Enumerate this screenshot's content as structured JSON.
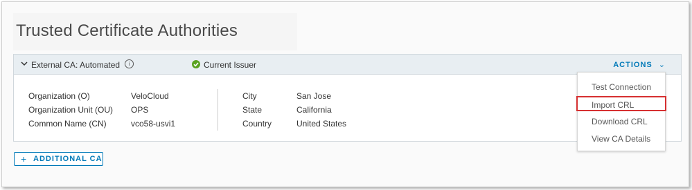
{
  "page": {
    "title": "Trusted Certificate Authorities"
  },
  "ca_card": {
    "name": "External CA: Automated",
    "status": "Current Issuer",
    "actions_label": "ACTIONS",
    "left_fields": [
      {
        "label": "Organization (O)",
        "value": "VeloCloud"
      },
      {
        "label": "Organization Unit (OU)",
        "value": "OPS"
      },
      {
        "label": "Common Name (CN)",
        "value": "vco58-usvi1"
      }
    ],
    "right_fields": [
      {
        "label": "City",
        "value": "San Jose"
      },
      {
        "label": "State",
        "value": "California"
      },
      {
        "label": "Country",
        "value": "United States"
      }
    ]
  },
  "actions_menu": {
    "items": [
      "Test Connection",
      "Import CRL",
      "Download CRL",
      "View CA Details"
    ],
    "highlighted_item": "Import CRL"
  },
  "add_button": {
    "label": "ADDITIONAL CA"
  },
  "colors": {
    "accent": "#0079b8",
    "success": "#5aa220",
    "highlight_border": "#d63031",
    "header_bg": "#e8eef2"
  },
  "icons": [
    "chevron-down-icon",
    "info-icon",
    "check-circle-icon",
    "plus-icon"
  ]
}
